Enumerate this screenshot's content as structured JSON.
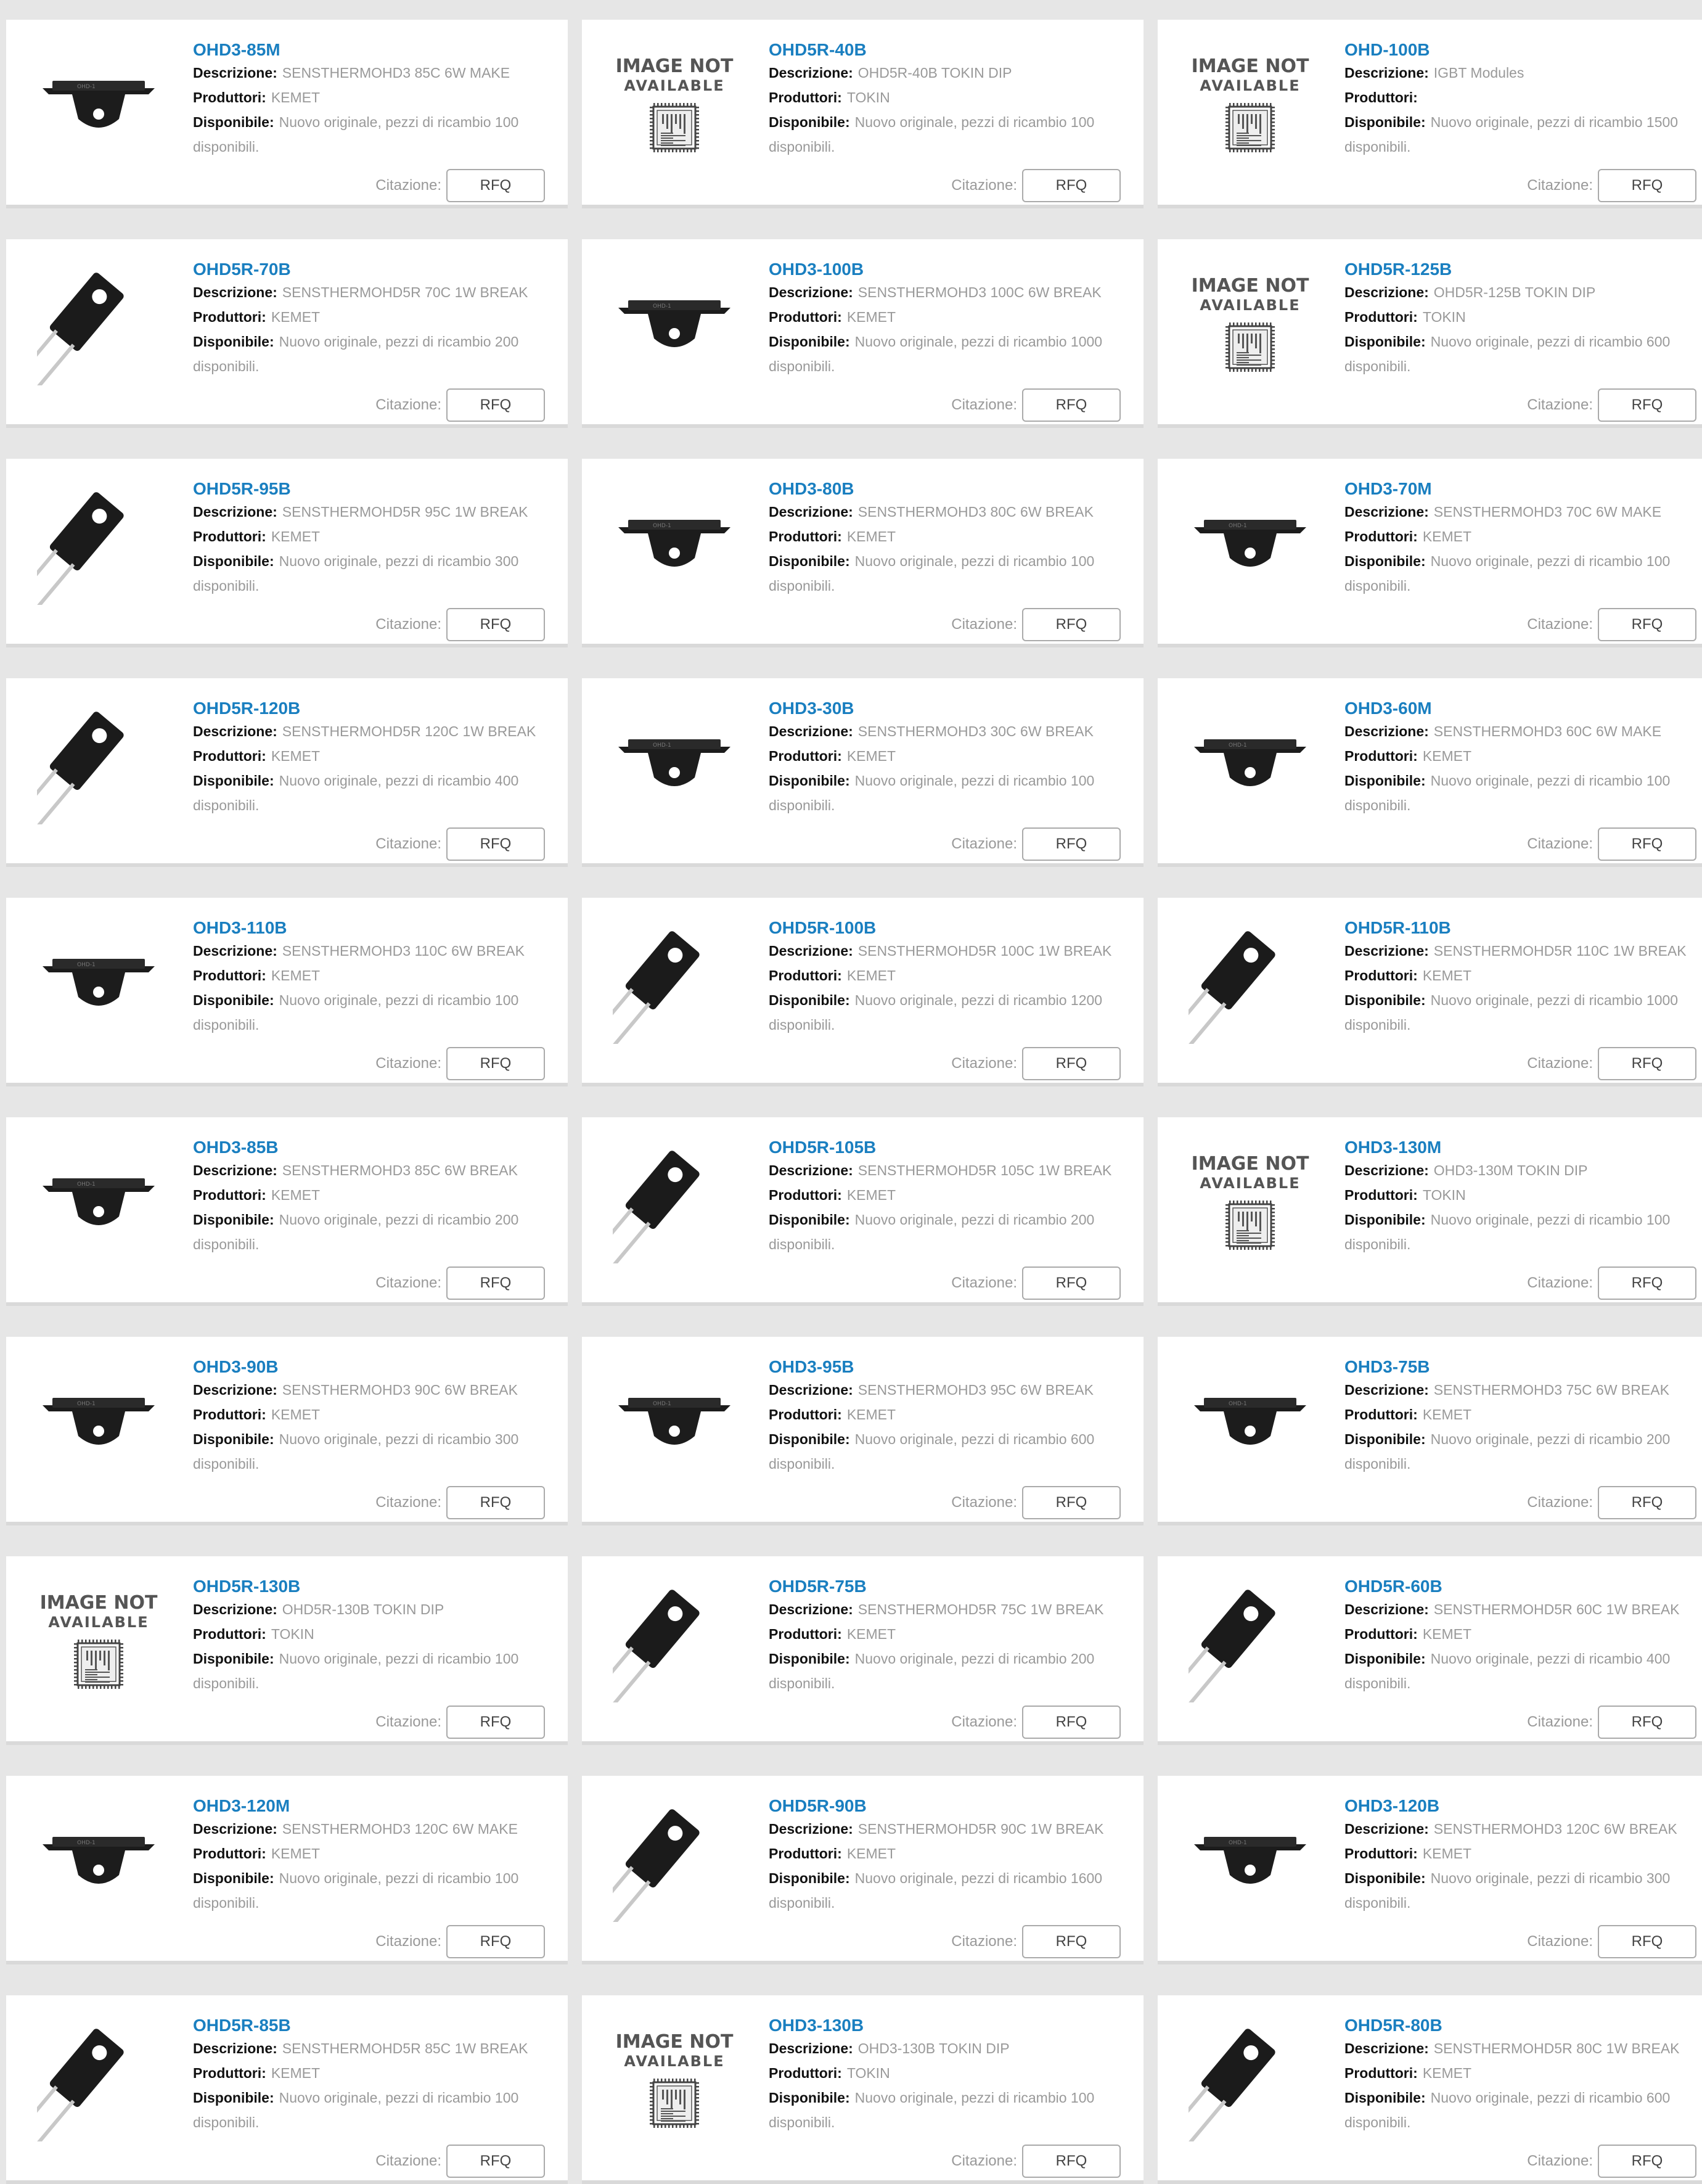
{
  "labels": {
    "description": "Descrizione:",
    "manufacturer": "Produttori:",
    "available": "Disponibile:",
    "quote": "Citazione:",
    "rfq": "RFQ",
    "image_not_available_1": "IMAGE NOT",
    "image_not_available_2": "AVAILABLE"
  },
  "products": [
    {
      "pn": "OHD3-85M",
      "desc": "SENSTHERMOHD3 85C 6W MAKE",
      "mfr": "KEMET",
      "avail": "Nuovo originale, pezzi di ricambio 100 disponibili.",
      "image": "flat"
    },
    {
      "pn": "OHD5R-40B",
      "desc": "OHD5R-40B TOKIN DIP",
      "mfr": "TOKIN",
      "avail": "Nuovo originale, pezzi di ricambio 100 disponibili.",
      "image": "na"
    },
    {
      "pn": "OHD-100B",
      "desc": "IGBT Modules",
      "mfr": "",
      "avail": "Nuovo originale, pezzi di ricambio 1500 disponibili.",
      "image": "na"
    },
    {
      "pn": "OHD5R-70B",
      "desc": "SENSTHERMOHD5R 70C 1W BREAK",
      "mfr": "KEMET",
      "avail": "Nuovo originale, pezzi di ricambio 200 disponibili.",
      "image": "leaded"
    },
    {
      "pn": "OHD3-100B",
      "desc": "SENSTHERMOHD3 100C 6W BREAK",
      "mfr": "KEMET",
      "avail": "Nuovo originale, pezzi di ricambio 1000 disponibili.",
      "image": "flat"
    },
    {
      "pn": "OHD5R-125B",
      "desc": "OHD5R-125B TOKIN DIP",
      "mfr": "TOKIN",
      "avail": "Nuovo originale, pezzi di ricambio 600 disponibili.",
      "image": "na"
    },
    {
      "pn": "OHD5R-95B",
      "desc": "SENSTHERMOHD5R 95C 1W BREAK",
      "mfr": "KEMET",
      "avail": "Nuovo originale, pezzi di ricambio 300 disponibili.",
      "image": "leaded"
    },
    {
      "pn": "OHD3-80B",
      "desc": "SENSTHERMOHD3 80C 6W BREAK",
      "mfr": "KEMET",
      "avail": "Nuovo originale, pezzi di ricambio 100 disponibili.",
      "image": "flat"
    },
    {
      "pn": "OHD3-70M",
      "desc": "SENSTHERMOHD3 70C 6W MAKE",
      "mfr": "KEMET",
      "avail": "Nuovo originale, pezzi di ricambio 100 disponibili.",
      "image": "flat"
    },
    {
      "pn": "OHD5R-120B",
      "desc": "SENSTHERMOHD5R 120C 1W BREAK",
      "mfr": "KEMET",
      "avail": "Nuovo originale, pezzi di ricambio 400 disponibili.",
      "image": "leaded"
    },
    {
      "pn": "OHD3-30B",
      "desc": "SENSTHERMOHD3 30C 6W BREAK",
      "mfr": "KEMET",
      "avail": "Nuovo originale, pezzi di ricambio 100 disponibili.",
      "image": "flat"
    },
    {
      "pn": "OHD3-60M",
      "desc": "SENSTHERMOHD3 60C 6W MAKE",
      "mfr": "KEMET",
      "avail": "Nuovo originale, pezzi di ricambio 100 disponibili.",
      "image": "flat"
    },
    {
      "pn": "OHD3-110B",
      "desc": "SENSTHERMOHD3 110C 6W BREAK",
      "mfr": "KEMET",
      "avail": "Nuovo originale, pezzi di ricambio 100 disponibili.",
      "image": "flat"
    },
    {
      "pn": "OHD5R-100B",
      "desc": "SENSTHERMOHD5R 100C 1W BREAK",
      "mfr": "KEMET",
      "avail": "Nuovo originale, pezzi di ricambio 1200 disponibili.",
      "image": "leaded"
    },
    {
      "pn": "OHD5R-110B",
      "desc": "SENSTHERMOHD5R 110C 1W BREAK",
      "mfr": "KEMET",
      "avail": "Nuovo originale, pezzi di ricambio 1000 disponibili.",
      "image": "leaded"
    },
    {
      "pn": "OHD3-85B",
      "desc": "SENSTHERMOHD3 85C 6W BREAK",
      "mfr": "KEMET",
      "avail": "Nuovo originale, pezzi di ricambio 200 disponibili.",
      "image": "flat"
    },
    {
      "pn": "OHD5R-105B",
      "desc": "SENSTHERMOHD5R 105C 1W BREAK",
      "mfr": "KEMET",
      "avail": "Nuovo originale, pezzi di ricambio 200 disponibili.",
      "image": "leaded"
    },
    {
      "pn": "OHD3-130M",
      "desc": "OHD3-130M TOKIN DIP",
      "mfr": "TOKIN",
      "avail": "Nuovo originale, pezzi di ricambio 100 disponibili.",
      "image": "na"
    },
    {
      "pn": "OHD3-90B",
      "desc": "SENSTHERMOHD3 90C 6W BREAK",
      "mfr": "KEMET",
      "avail": "Nuovo originale, pezzi di ricambio 300 disponibili.",
      "image": "flat"
    },
    {
      "pn": "OHD3-95B",
      "desc": "SENSTHERMOHD3 95C 6W BREAK",
      "mfr": "KEMET",
      "avail": "Nuovo originale, pezzi di ricambio 600 disponibili.",
      "image": "flat"
    },
    {
      "pn": "OHD3-75B",
      "desc": "SENSTHERMOHD3 75C 6W BREAK",
      "mfr": "KEMET",
      "avail": "Nuovo originale, pezzi di ricambio 200 disponibili.",
      "image": "flat"
    },
    {
      "pn": "OHD5R-130B",
      "desc": "OHD5R-130B TOKIN DIP",
      "mfr": "TOKIN",
      "avail": "Nuovo originale, pezzi di ricambio 100 disponibili.",
      "image": "na"
    },
    {
      "pn": "OHD5R-75B",
      "desc": "SENSTHERMOHD5R 75C 1W BREAK",
      "mfr": "KEMET",
      "avail": "Nuovo originale, pezzi di ricambio 200 disponibili.",
      "image": "leaded"
    },
    {
      "pn": "OHD5R-60B",
      "desc": "SENSTHERMOHD5R 60C 1W BREAK",
      "mfr": "KEMET",
      "avail": "Nuovo originale, pezzi di ricambio 400 disponibili.",
      "image": "leaded"
    },
    {
      "pn": "OHD3-120M",
      "desc": "SENSTHERMOHD3 120C 6W MAKE",
      "mfr": "KEMET",
      "avail": "Nuovo originale, pezzi di ricambio 100 disponibili.",
      "image": "flat"
    },
    {
      "pn": "OHD5R-90B",
      "desc": "SENSTHERMOHD5R 90C 1W BREAK",
      "mfr": "KEMET",
      "avail": "Nuovo originale, pezzi di ricambio 1600 disponibili.",
      "image": "leaded"
    },
    {
      "pn": "OHD3-120B",
      "desc": "SENSTHERMOHD3 120C 6W BREAK",
      "mfr": "KEMET",
      "avail": "Nuovo originale, pezzi di ricambio 300 disponibili.",
      "image": "flat"
    },
    {
      "pn": "OHD5R-85B",
      "desc": "SENSTHERMOHD5R 85C 1W BREAK",
      "mfr": "KEMET",
      "avail": "Nuovo originale, pezzi di ricambio 100 disponibili.",
      "image": "leaded"
    },
    {
      "pn": "OHD3-130B",
      "desc": "OHD3-130B TOKIN DIP",
      "mfr": "TOKIN",
      "avail": "Nuovo originale, pezzi di ricambio 100 disponibili.",
      "image": "na"
    },
    {
      "pn": "OHD5R-80B",
      "desc": "SENSTHERMOHD5R 80C 1W BREAK",
      "mfr": "KEMET",
      "avail": "Nuovo originale, pezzi di ricambio 600 disponibili.",
      "image": "leaded"
    }
  ]
}
